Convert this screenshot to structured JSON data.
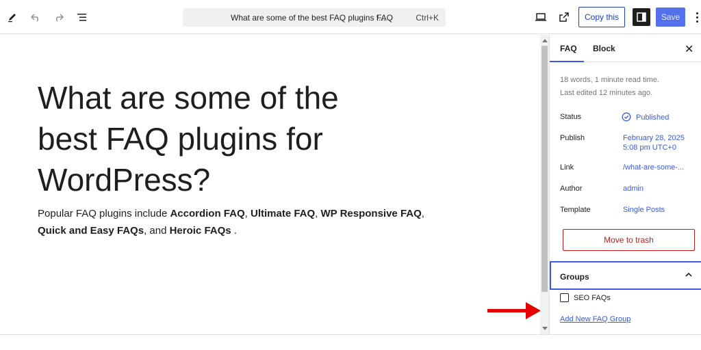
{
  "toolbar": {
    "command_title": "What are some of the best FAQ plugins f...",
    "post_type": "FAQ",
    "shortcut": "Ctrl+K",
    "copy_label": "Copy this",
    "save_label": "Save"
  },
  "post": {
    "title": "What are some of the best FAQ plugins for WordPress?",
    "para_prefix": "Popular FAQ plugins include ",
    "plugins": [
      "Accordion FAQ",
      "Ultimate FAQ",
      "WP Responsive FAQ",
      "Quick and Easy FAQs",
      "Heroic FAQs"
    ],
    "sep1": ", ",
    "sep_and": ", and ",
    "para_suffix": " ."
  },
  "sidebar": {
    "tab_post": "FAQ",
    "tab_block": "Block",
    "word_count": "18 words, 1 minute read time.",
    "last_edited": "Last edited 12 minutes ago.",
    "status_label": "Status",
    "status_value": "Published",
    "publish_label": "Publish",
    "publish_date": "February 28, 2025",
    "publish_time": "5:08 pm UTC+0",
    "link_label": "Link",
    "link_value": "/what-are-some-...",
    "author_label": "Author",
    "author_value": "admin",
    "template_label": "Template",
    "template_value": "Single Posts",
    "trash_label": "Move to trash",
    "groups_label": "Groups",
    "group_option": "SEO FAQs",
    "add_group_link": "Add New FAQ Group"
  },
  "colors": {
    "accent": "#3858e9",
    "danger": "#cc1818",
    "arrow": "#e60000"
  }
}
